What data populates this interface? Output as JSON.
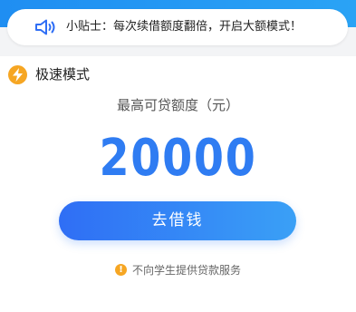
{
  "tip": {
    "icon": "speaker-icon",
    "text": "小贴士：每次续借额度翻倍，开启大额模式！"
  },
  "mode": {
    "icon": "lightning-icon",
    "label": "极速模式",
    "icon_color": "#f6a623"
  },
  "amount": {
    "caption": "最高可贷额度（元）",
    "value": "20000",
    "color": "#2f7cf2"
  },
  "borrow_button": {
    "label": "去借钱"
  },
  "notice": {
    "icon": "warning-icon",
    "text": "不向学生提供贷款服务"
  },
  "colors": {
    "accent": "#2f7cf2",
    "header": "#1f8ef2",
    "warning": "#f6a623"
  }
}
